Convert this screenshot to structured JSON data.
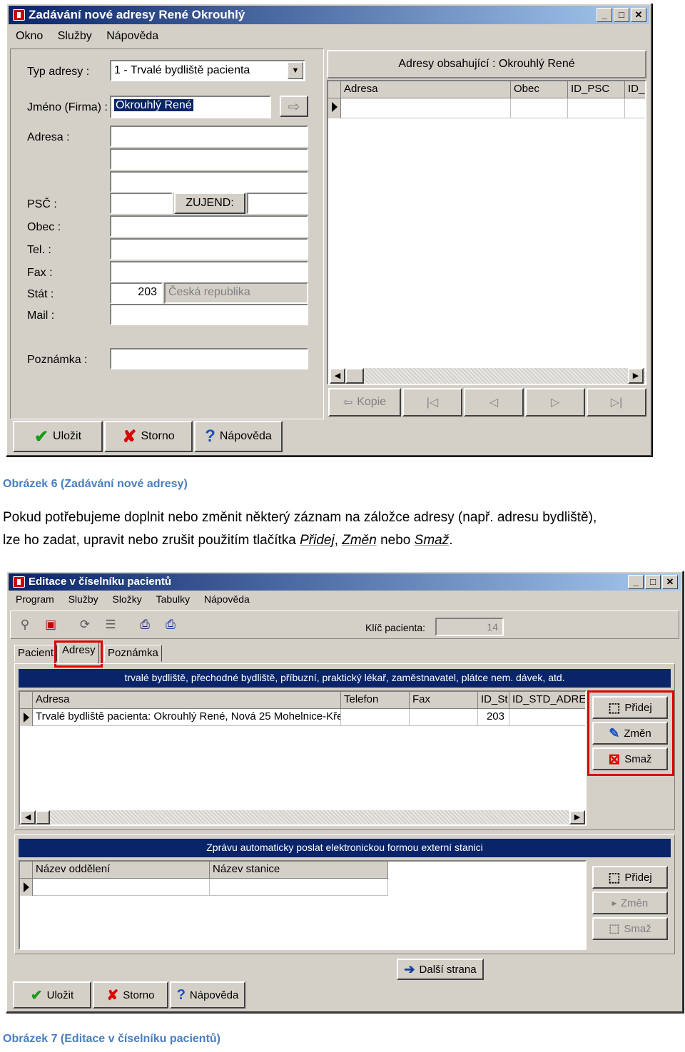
{
  "win1": {
    "title": "Zadávání nové adresy  René Okrouhlý",
    "menu": [
      "Okno",
      "Služby",
      "Nápověda"
    ],
    "labels": {
      "typ": "Typ adresy :",
      "jmeno": "Jméno (Firma) :",
      "adresa": "Adresa :",
      "psc": "PSČ :",
      "zujend": "ZUJEND:",
      "obec": "Obec :",
      "tel": "Tel. :",
      "fax": "Fax :",
      "stat": "Stát :",
      "mail": "Mail :",
      "poznamka": "Poznámka :"
    },
    "typ_value": "1 - Trvalé bydliště pacienta",
    "jmeno_value": "Okrouhlý René",
    "stat_code": "203",
    "stat_name": "Česká republika",
    "grid_title": "Adresy obsahující : Okrouhlý René",
    "grid_cols": [
      "Adresa",
      "Obec",
      "ID_PSC",
      "ID_"
    ],
    "kopie": "Kopie",
    "nav_glyphs": [
      "|◁",
      "◁",
      "▷",
      "▷|"
    ],
    "buttons": {
      "ulozit": "Uložit",
      "storno": "Storno",
      "napoveda": "Nápověda"
    }
  },
  "caption1": "Obrázek 6 (Zadávání nové adresy)",
  "paragraph": {
    "line1": "Pokud potřebujeme doplnit nebo změnit některý záznam na záložce adresy (např. adresu bydliště),",
    "line2_a": "lze ho zadat, upravit nebo zrušit použitím tlačítka ",
    "line2_b": "Přidej",
    "line2_c": ", ",
    "line2_d": "Změn",
    "line2_e": " nebo ",
    "line2_f": "Smaž",
    "line2_g": "."
  },
  "win2": {
    "title": "Editace v číselníku pacientů",
    "menu": [
      "Program",
      "Služby",
      "Složky",
      "Tabulky",
      "Nápověda"
    ],
    "klic_label": "Klíč pacienta:",
    "klic_value": "14",
    "tabs": [
      "Pacient",
      "Adresy",
      "Poznámka"
    ],
    "bar1": "trvalé bydliště, přechodné bydliště, příbuzní, praktický lékař, zaměstnavatel, plátce nem. dávek, atd.",
    "grid1_cols": [
      "Adresa",
      "Telefon",
      "Fax",
      "ID_St",
      "ID_STD_ADRES"
    ],
    "grid1_row": [
      "Trvalé bydliště pacienta:  Okrouhlý René, Nová 25   Mohelnice-Kře",
      "",
      "",
      "203",
      ""
    ],
    "bar2": "Zprávu automaticky poslat elektronickou formou externí stanici",
    "grid2_cols": [
      "Název oddělení",
      "Název stanice"
    ],
    "side_buttons": {
      "pridej": "Přidej",
      "zmen": "Změn",
      "smaz": "Smaž"
    },
    "dalsi": "Další strana",
    "buttons": {
      "ulozit": "Uložit",
      "storno": "Storno",
      "napoveda": "Nápověda"
    }
  },
  "caption2": "Obrázek 7 (Editace v číselníku pacientů)"
}
